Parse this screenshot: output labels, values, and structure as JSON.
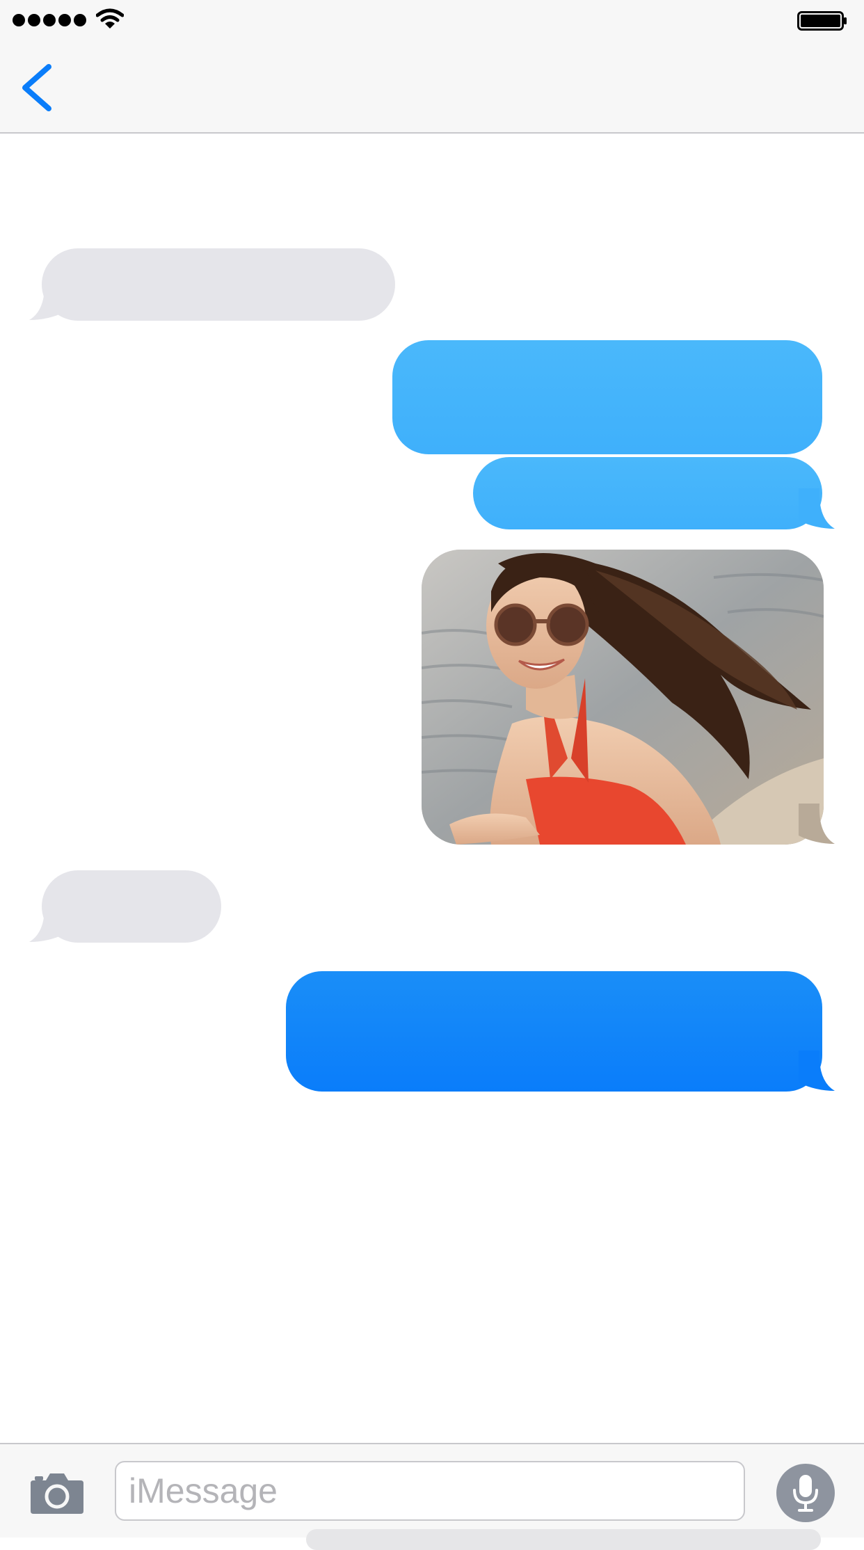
{
  "status_bar": {
    "signal_icon": "signal-dots-icon",
    "wifi_icon": "wifi-icon",
    "battery_icon": "battery-icon",
    "signal_bars": 5
  },
  "nav_bar": {
    "back_icon": "chevron-left-icon"
  },
  "colors": {
    "accent": "#0a7dfa",
    "received_bubble": "#e5e5ea",
    "sent_bubble_light": "#46b4fb",
    "sent_bubble_dark": "#0a7dfa"
  },
  "messages": [
    {
      "direction": "received",
      "type": "text",
      "text": ""
    },
    {
      "direction": "sent",
      "type": "text",
      "text": ""
    },
    {
      "direction": "sent",
      "type": "text",
      "text": ""
    },
    {
      "direction": "sent",
      "type": "image",
      "image": "beach-portrait-photo"
    },
    {
      "direction": "received",
      "type": "text",
      "text": ""
    },
    {
      "direction": "sent",
      "type": "text",
      "text": ""
    }
  ],
  "composer": {
    "camera_icon": "camera-icon",
    "placeholder": "iMessage",
    "value": "",
    "mic_icon": "microphone-icon"
  }
}
